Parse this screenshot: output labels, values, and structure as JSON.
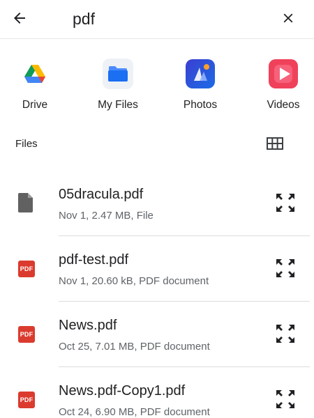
{
  "search": {
    "query": "pdf",
    "back_icon": "arrow-left-icon",
    "clear_icon": "close-icon"
  },
  "apps": [
    {
      "label": "Drive",
      "icon": "google-drive-icon"
    },
    {
      "label": "My Files",
      "icon": "folder-icon"
    },
    {
      "label": "Photos",
      "icon": "photos-icon"
    },
    {
      "label": "Videos",
      "icon": "play-icon"
    }
  ],
  "files_section": {
    "title": "Files",
    "view_toggle_icon": "grid-view-icon"
  },
  "files": [
    {
      "name": "05dracula.pdf",
      "meta": "Nov 1, 2.47 MB, File",
      "icon": "generic-file-icon"
    },
    {
      "name": "pdf-test.pdf",
      "meta": "Nov 1, 20.60 kB, PDF document",
      "icon": "pdf-icon",
      "badge": "PDF"
    },
    {
      "name": "News.pdf",
      "meta": "Oct 25, 7.01 MB, PDF document",
      "icon": "pdf-icon",
      "badge": "PDF"
    },
    {
      "name": "News.pdf-Copy1.pdf",
      "meta": "Oct 24, 6.90 MB, PDF document",
      "icon": "pdf-icon",
      "badge": "PDF"
    }
  ],
  "colors": {
    "pdf_red": "#db3b2e",
    "file_gray": "#5f6368",
    "divider": "#dadce0"
  }
}
